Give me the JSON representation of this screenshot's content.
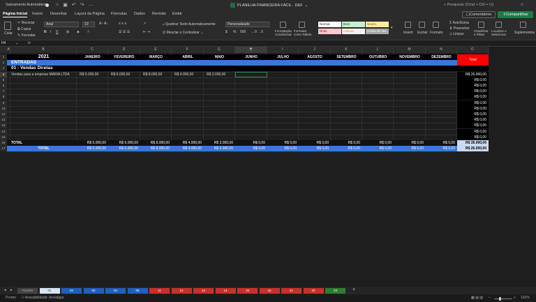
{
  "titlebar": {
    "autosave": "Salvamento Automático",
    "doc_title": "PLANILHA FINANCEIRA FÁCIL - DEF",
    "search_placeholder": "Pesquisar (Cmd + Ctrl + U)"
  },
  "menu": {
    "tabs": [
      "Página Inicial",
      "Inserir",
      "Desenhar",
      "Layout da Página",
      "Fórmulas",
      "Dados",
      "Revisão",
      "Exibir"
    ],
    "comments": "Comentários",
    "share": "Compartilhar"
  },
  "ribbon": {
    "paste": "Colar",
    "cut": "Recortar",
    "copy": "Copiar",
    "format_painter": "Formatar",
    "font_name": "Arial",
    "font_size": "10",
    "wrap_text": "Quebrar Texto Automaticamente",
    "merge_center": "Mesclar e Centralizar",
    "number_format": "Personalizado",
    "number_pct": "%",
    "number_thousands": "000",
    "cond_format": "Formatação Condicional",
    "format_table": "Formatar como Tabela",
    "styles": [
      "Normal",
      "Bom",
      "Neutro",
      "Ruim",
      "Cálculo",
      "Célula de Ver..."
    ],
    "insert": "Inserir",
    "delete": "Excluir",
    "format": "Formato",
    "autosum": "AutoSoma",
    "fill": "Preencher",
    "clear": "Limpar",
    "sort_filter": "Classificar e Filtrar",
    "find_select": "Localizar e Selecionar",
    "addins": "Suplementos"
  },
  "formula": {
    "namebox": "H4",
    "fx": "fx"
  },
  "grid": {
    "columns": [
      "A",
      "B",
      "C",
      "D",
      "E",
      "F",
      "G",
      "H",
      "I",
      "J",
      "K",
      "L",
      "M",
      "N",
      "O"
    ],
    "rows": [
      "1",
      "2",
      "3",
      "4",
      "5",
      "6",
      "7",
      "8",
      "9",
      "10",
      "11",
      "12",
      "13",
      "14",
      "15",
      "16",
      "17"
    ],
    "year": "2021",
    "months": [
      "JANEIRO",
      "FEVEREIRO",
      "MARÇO",
      "ABRIL",
      "MAIO",
      "JUNHO",
      "JULHO",
      "AGOSTO",
      "SETEMBRO",
      "OUTUBRO",
      "NOVEMBRO",
      "DEZEMBRO"
    ],
    "total_header": "Total",
    "section": "ENTRADAS",
    "subsection": "01 - Vendas Diretas",
    "row4_label": "Vendas para a empresa MARIA LTDA",
    "row4_values": [
      "R$ 5.000,00",
      "R$ 6.000,00",
      "R$ 8.000,00",
      "R$ 4.000,00",
      "R$ 3.000,00",
      "",
      "",
      "",
      "",
      "",
      "",
      ""
    ],
    "row4_total": "R$ 26.000,00",
    "zero": "R$ 0,00",
    "total_label": "TOTAL",
    "total_values": [
      "R$ 5.000,00",
      "R$ 6.000,00",
      "R$ 8.000,00",
      "R$ 4.000,00",
      "R$ 3.000,00",
      "R$ 0,00",
      "R$ 0,00",
      "R$ 0,00",
      "R$ 0,00",
      "R$ 0,00",
      "R$ 0,00",
      "R$ 0,00"
    ],
    "grand_total": "R$ 26.000,00"
  },
  "sheets": [
    "FLUXO",
    "01",
    "02",
    "03",
    "04",
    "05",
    "11",
    "12",
    "13",
    "14",
    "15",
    "16",
    "21",
    "22",
    "23"
  ],
  "status": {
    "ready": "Pronto",
    "accessibility": "Acessibilidade: investigar",
    "zoom": "132%"
  },
  "colors": {
    "header_blue": "#3a78d8",
    "total_red": "#ff0000",
    "accent_green": "#1c7a44",
    "tab_blue": "#1f5fbf",
    "tab_red": "#c9302c",
    "tab_green": "#2e7d32"
  }
}
